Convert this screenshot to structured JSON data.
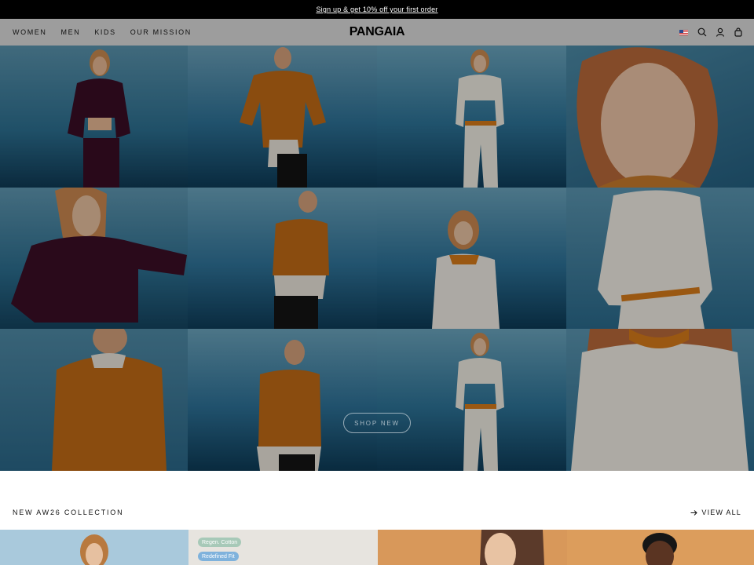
{
  "announcement": {
    "text": "Sign up & get 10% off your first order"
  },
  "nav": {
    "items": [
      {
        "label": "WOMEN"
      },
      {
        "label": "MEN"
      },
      {
        "label": "KIDS"
      },
      {
        "label": "OUR MISSION"
      }
    ]
  },
  "header": {
    "logo": "PANGAIA",
    "icons": [
      "flag-us-icon",
      "search-icon",
      "account-icon",
      "bag-icon"
    ]
  },
  "hero": {
    "cta": "SHOP NEW"
  },
  "collection": {
    "title": "NEW AW26 COLLECTION",
    "view_all": "VIEW ALL",
    "badges": [
      {
        "label": "Regen. Cotton",
        "color": "#a7c9b8"
      },
      {
        "label": "Redefined Fit",
        "color": "#7fb2dc"
      }
    ]
  },
  "colors": {
    "announcement_bg": "#000000",
    "header_bg": "#9d9d9d",
    "hero_backdrop": "#2f6f8f"
  }
}
